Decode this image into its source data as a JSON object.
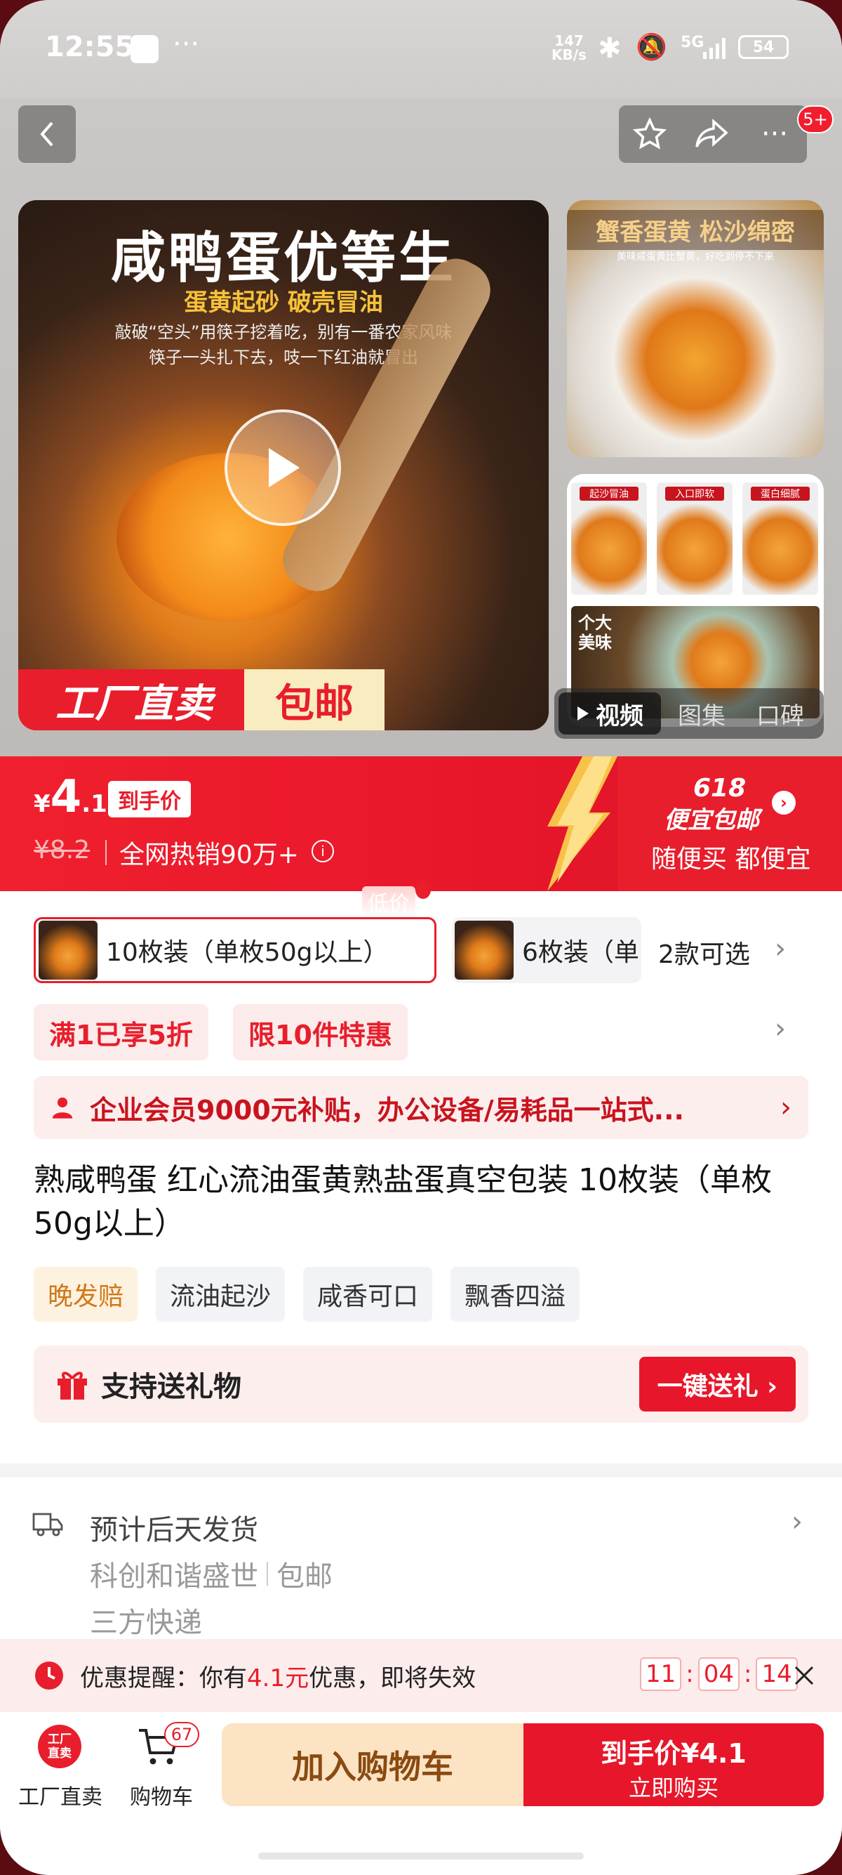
{
  "status_bar": {
    "time": "12:55",
    "net_speed_top": "147",
    "net_speed_unit": "KB/s",
    "signal": "5G",
    "battery": "54"
  },
  "header": {
    "more_badge": "5+"
  },
  "gallery": {
    "main_title": "咸鸭蛋优等生",
    "main_subtitle": "蛋黄起砂 破壳冒油",
    "main_desc1": "敲破“空头”用筷子挖着吃，别有一番农家风味",
    "main_desc2": "筷子一头扎下去，吱一下红油就冒出",
    "badge_left": "工厂直卖",
    "badge_right": "包邮",
    "thumb1_title": "蟹香蛋黄 松沙绵密",
    "thumb1_sub": "美味咸蛋黄比蟹黄，好吃到停不下来",
    "thumb2_labels": [
      "起沙冒油",
      "入口即软",
      "蛋白细腻"
    ],
    "thumb2_bottom": "个大美味",
    "tabs": [
      "视频",
      "图集",
      "口碑"
    ]
  },
  "price": {
    "currency": "¥",
    "integer": "4",
    "decimal": ".1",
    "tag": "到手价",
    "original": "¥8.2",
    "sales": "全网热销90万+",
    "promo_618": "618",
    "promo_main": "便宜包邮",
    "promo_sub": "随便买 都便宜"
  },
  "variants": {
    "low_tag": "低价",
    "items": [
      {
        "label": "10枚装（单枚50g以上）"
      },
      {
        "label": "6枚装（单"
      }
    ],
    "more": "2款可选"
  },
  "coupons": [
    "满1已享5折",
    "限10件特惠"
  ],
  "member_banner": "企业会员9000元补贴，办公设备/易耗品一站式...",
  "product": {
    "title": "熟咸鸭蛋 红心流油蛋黄熟盐蛋真空包装 10枚装（单枚50g以上）",
    "tags": [
      "晚发赔",
      "流油起沙",
      "咸香可口",
      "飘香四溢"
    ]
  },
  "gift": {
    "label": "支持送礼物",
    "button": "一键送礼 ›"
  },
  "shipping": {
    "estimate": "预计后天发货",
    "store": "科创和谐盛世",
    "free": "包邮",
    "courier": "三方快递"
  },
  "reminder": {
    "prefix": "优惠提醒：你有",
    "amount": "4.1元",
    "suffix": "优惠，即将失效",
    "hh": "11",
    "mm": "04",
    "ss": "14"
  },
  "bottom_bar": {
    "factory_label": "工厂直卖",
    "factory_icon_text": "工厂直卖",
    "cart_label": "购物车",
    "cart_count": "67",
    "add_cart": "加入购物车",
    "buy_price": "到手价¥4.1",
    "buy_now": "立即购买"
  },
  "colors": {
    "accent": "#e8162a",
    "gold": "#f6dcb0",
    "brown": "#8a4a12"
  }
}
